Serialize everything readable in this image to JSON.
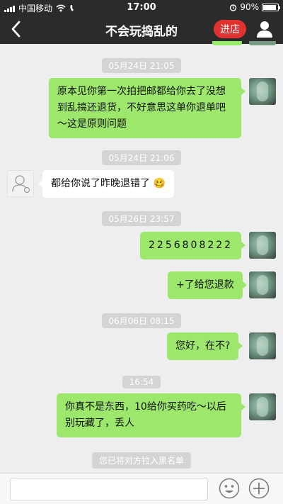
{
  "status_bar": {
    "carrier": "中国移动",
    "time": "17:00",
    "battery_percent": "90%",
    "battery_level": 0.9
  },
  "header": {
    "title": "不会玩捣乱的",
    "shop_button": "进店"
  },
  "messages": [
    {
      "timestamp": "05月24日 21:05"
    },
    {
      "sender": "me",
      "text": "原本见你第一次拍把邮都给你去了没想到乱搞还退货，不好意思这单你退单吧～这是原则问题"
    },
    {
      "timestamp": "05月24日 21:06"
    },
    {
      "sender": "them",
      "text": "都给你说了昨晚退错了 🥴"
    },
    {
      "timestamp": "05月26日 23:57"
    },
    {
      "sender": "me",
      "text": "2256808222"
    },
    {
      "sender": "me",
      "text": "+了给您退款"
    },
    {
      "timestamp": "06月06日 08:15"
    },
    {
      "sender": "me",
      "text": "您好，在不?"
    },
    {
      "timestamp": "16:54"
    },
    {
      "sender": "me",
      "text": "你真不是东西，10给你买药吃～以后别玩藏了，丢人"
    }
  ],
  "notice": "您已将对方拉入黑名单",
  "input": {
    "placeholder": "",
    "emoji_icon": "emoji-icon",
    "plus_icon": "plus-icon"
  },
  "colors": {
    "header_bg": "#2b2b2b",
    "my_bubble": "#9de76c",
    "their_bubble": "#ffffff",
    "shop_button": "#e0332f",
    "chat_bg": "#eeeeee"
  }
}
